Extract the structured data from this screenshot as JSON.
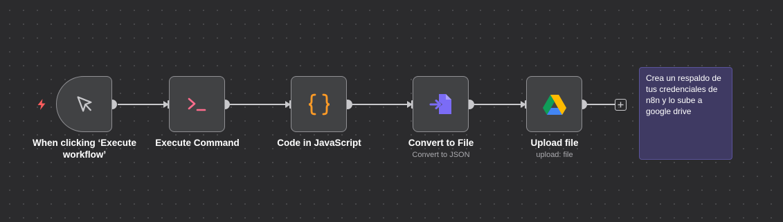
{
  "workflow": {
    "nodes": [
      {
        "id": "trigger",
        "label": "When clicking ‘Execute\nworkflow’",
        "sublabel": "",
        "icon": "cursor-icon"
      },
      {
        "id": "exec",
        "label": "Execute Command",
        "sublabel": "",
        "icon": "terminal-icon"
      },
      {
        "id": "code",
        "label": "Code in JavaScript",
        "sublabel": "",
        "icon": "braces-icon"
      },
      {
        "id": "convert",
        "label": "Convert to File",
        "sublabel": "Convert to JSON",
        "icon": "file-import-icon"
      },
      {
        "id": "upload",
        "label": "Upload file",
        "sublabel": "upload: file",
        "icon": "google-drive-icon"
      }
    ],
    "sticky_note": "Crea un respaldo de tus credenciales de n8n y lo sube a google drive"
  },
  "colors": {
    "canvas": "#2b2b2d",
    "node_bg": "#414244",
    "node_border": "#909094",
    "connector": "#c9c9cc",
    "trigger_bolt": "#ff5d5d",
    "terminal_icon": "#ff6d8d",
    "braces_icon": "#ff9b26",
    "file_icon": "#7b6cf6",
    "sticky_bg": "#3f3a63"
  }
}
